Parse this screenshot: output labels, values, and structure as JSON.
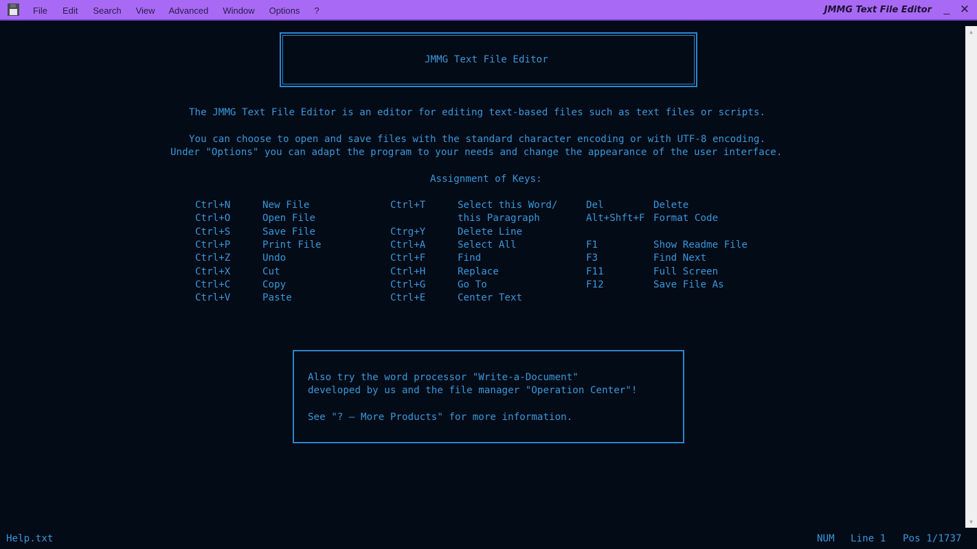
{
  "titlebar": {
    "app_icon": "floppy-disk-icon",
    "menu": [
      "File",
      "Edit",
      "Search",
      "View",
      "Advanced",
      "Window",
      "Options",
      "?"
    ],
    "window_title": "JMMG Text File Editor",
    "minimize": "_",
    "close": "✕"
  },
  "document": {
    "header_title": "JMMG Text File Editor",
    "intro": "The JMMG Text File Editor is an editor for editing text-based files such as text files or scripts.",
    "encoding_line": "You can choose to open and save files with the standard character encoding or with UTF-8 encoding.",
    "options_line": "Under \"Options\" you can adapt the program to your needs and change the appearance of the user interface.",
    "keys_heading": "Assignment of Keys:",
    "keys_col1": [
      {
        "key": "Ctrl+N",
        "action": "New File"
      },
      {
        "key": "Ctrl+O",
        "action": "Open File"
      },
      {
        "key": "Ctrl+S",
        "action": "Save File"
      },
      {
        "key": "Ctrl+P",
        "action": "Print File"
      },
      {
        "key": "Ctrl+Z",
        "action": "Undo"
      },
      {
        "key": "Ctrl+X",
        "action": "Cut"
      },
      {
        "key": "Ctrl+C",
        "action": "Copy"
      },
      {
        "key": "Ctrl+V",
        "action": "Paste"
      }
    ],
    "keys_col2": [
      {
        "key": "Ctrl+T",
        "action": "Select this Word/"
      },
      {
        "key": "",
        "action": "this Paragraph"
      },
      {
        "key": "Ctrg+Y",
        "action": "Delete Line"
      },
      {
        "key": "Ctrl+A",
        "action": "Select All"
      },
      {
        "key": "Ctrl+F",
        "action": "Find"
      },
      {
        "key": "Ctrl+H",
        "action": "Replace"
      },
      {
        "key": "Ctrl+G",
        "action": "Go To"
      },
      {
        "key": "Ctrl+E",
        "action": "Center Text"
      }
    ],
    "keys_col3": [
      {
        "key": "Del",
        "action": "Delete"
      },
      {
        "key": "Alt+Shft+F",
        "action": "Format Code"
      },
      {
        "key": "",
        "action": ""
      },
      {
        "key": "F1",
        "action": "Show Readme File"
      },
      {
        "key": "F3",
        "action": "Find Next"
      },
      {
        "key": "F11",
        "action": "Full Screen"
      },
      {
        "key": "F12",
        "action": "Save File As"
      }
    ],
    "promo_line1": "Also try the word processor \"Write-a-Document\"",
    "promo_line2": "developed by us and the file manager \"Operation Center\"!",
    "promo_line3": "See \"? – More Products\" for more information."
  },
  "scrollbar": {
    "up_arrow": "▲",
    "down_arrow": "▼"
  },
  "statusbar": {
    "filename": "Help.txt",
    "num": "NUM",
    "line": "Line 1",
    "pos": "Pos 1/1737"
  },
  "colors": {
    "titlebar_bg": "#a86af5",
    "editor_bg": "#030b16",
    "text": "#3a97dc",
    "frame": "#2d86cf"
  }
}
